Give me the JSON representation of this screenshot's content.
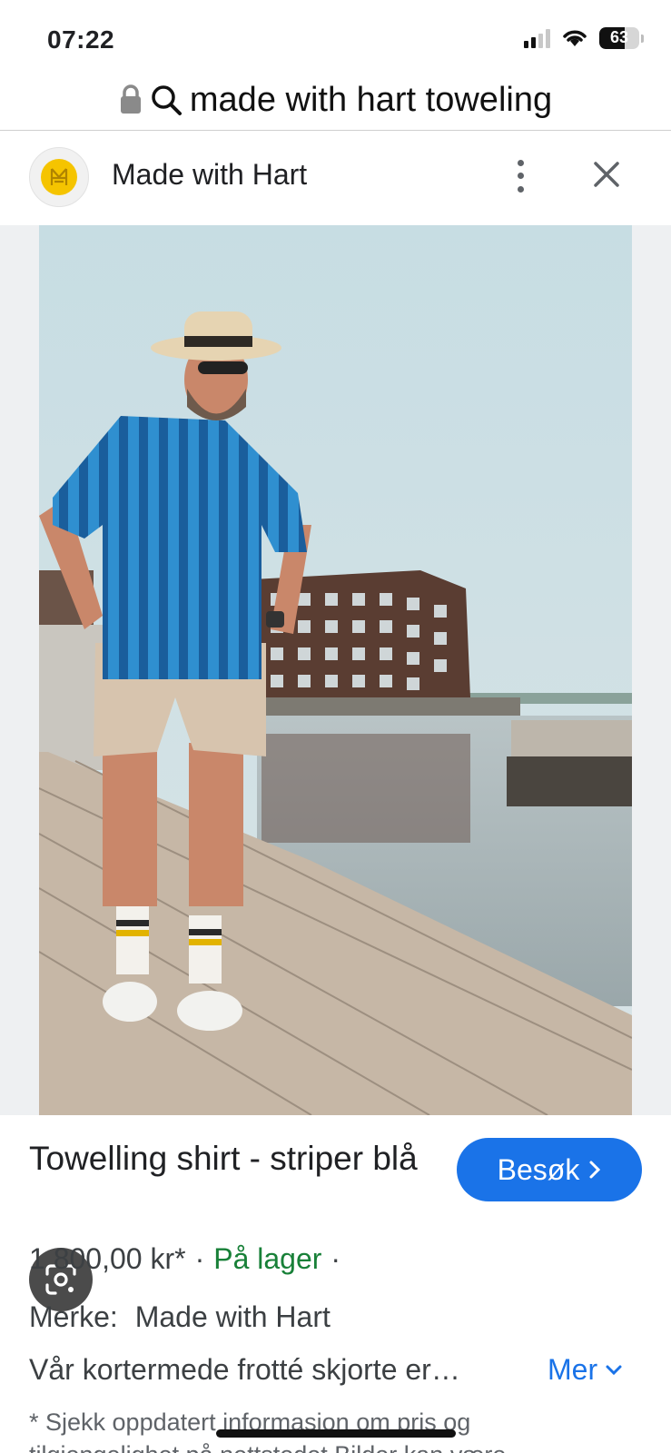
{
  "status_bar": {
    "time": "07:22",
    "battery": "63",
    "battery_level": 0.63,
    "icons": [
      "cellular-signal-icon",
      "wifi-icon",
      "battery-icon"
    ]
  },
  "url_bar": {
    "lock_icon": "lock-icon",
    "search_icon": "search-icon",
    "query": "made with hart toweling"
  },
  "source": {
    "name": "Made with Hart",
    "logo_color": "#f5c400",
    "logo_icon": "made-with-hart-logo-icon",
    "menu_icon": "more-vert-icon",
    "close_icon": "close-icon"
  },
  "image": {
    "lens_icon": "google-lens-icon"
  },
  "product": {
    "title": "Towelling shirt - striper blå",
    "visit_label": "Besøk",
    "visit_icon": "chevron-right-icon",
    "price": "1 800,00 kr*",
    "sep1": "·",
    "stock": "På lager",
    "sep2": "·",
    "brand_label": "Merke:",
    "brand_value": "Made with Hart",
    "description": "Vår kortermede frotté skjorte er…",
    "more_label": "Mer",
    "more_icon": "chevron-down-icon",
    "disclaimer_pre": "* Sjekk oppdatert informasjon om pris og",
    "disclaimer_link": "tilgjengelighet på nettstedet",
    "disclaimer_post": " Bilder kan være"
  },
  "colors": {
    "accent": "#1a73e8",
    "stock_green": "#188038",
    "text": "#202124"
  }
}
